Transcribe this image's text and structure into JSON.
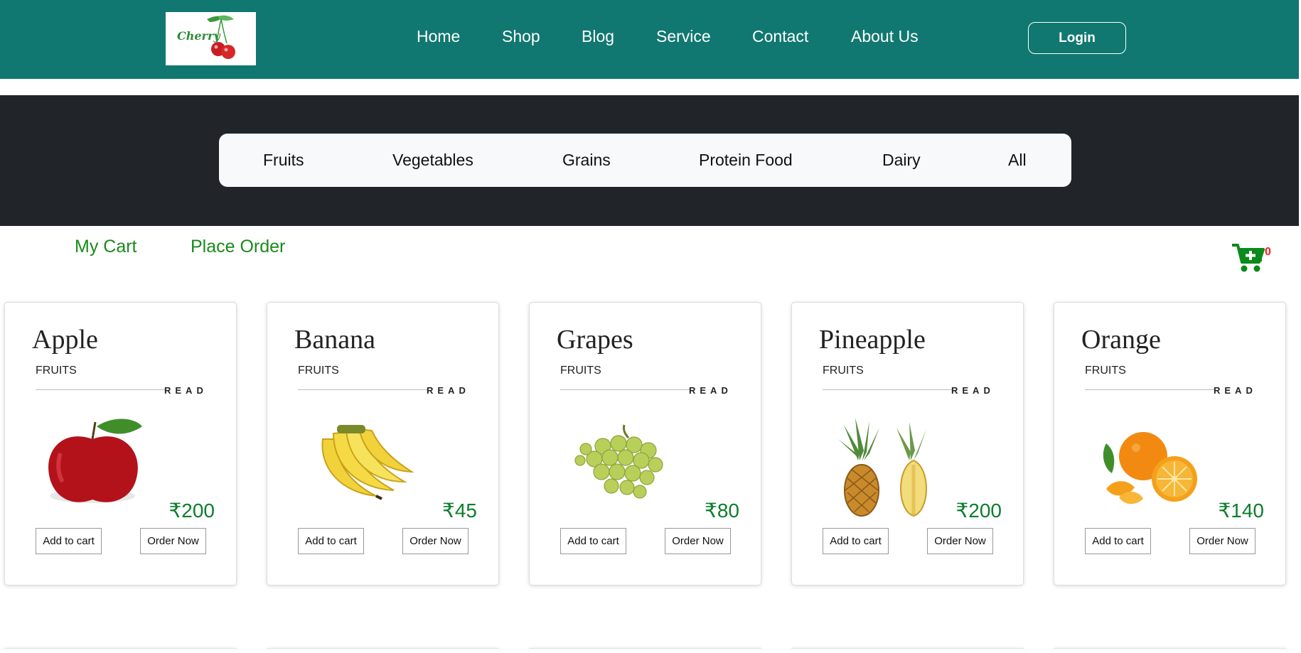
{
  "brand": {
    "logo_text": "Cherry"
  },
  "nav": {
    "links": [
      "Home",
      "Shop",
      "Blog",
      "Service",
      "Contact",
      "About Us"
    ],
    "login_label": "Login"
  },
  "categories": [
    "Fruits",
    "Vegetables",
    "Grains",
    "Protein Food",
    "Dairy",
    "All"
  ],
  "cart": {
    "my_cart_label": "My Cart",
    "place_order_label": "Place Order",
    "count": "0"
  },
  "products": [
    {
      "name": "Apple",
      "category": "FRUITS",
      "read_label": "READ",
      "price": "₹200",
      "add_label": "Add to cart",
      "order_label": "Order Now",
      "image_icon": "apple-image"
    },
    {
      "name": "Banana",
      "category": "FRUITS",
      "read_label": "READ",
      "price": "₹45",
      "add_label": "Add to cart",
      "order_label": "Order Now",
      "image_icon": "banana-image"
    },
    {
      "name": "Grapes",
      "category": "FRUITS",
      "read_label": "READ",
      "price": "₹80",
      "add_label": "Add to cart",
      "order_label": "Order Now",
      "image_icon": "grapes-image"
    },
    {
      "name": "Pineapple",
      "category": "FRUITS",
      "read_label": "READ",
      "price": "₹200",
      "add_label": "Add to cart",
      "order_label": "Order Now",
      "image_icon": "pineapple-image"
    },
    {
      "name": "Orange",
      "category": "FRUITS",
      "read_label": "READ",
      "price": "₹140",
      "add_label": "Add to cart",
      "order_label": "Order Now",
      "image_icon": "orange-image"
    }
  ],
  "colors": {
    "header_bg": "#107870",
    "band_bg": "#212529",
    "accent_green": "#1a8a1a",
    "price_green": "#0d7d2d",
    "cart_badge": "#ff1a1a"
  }
}
